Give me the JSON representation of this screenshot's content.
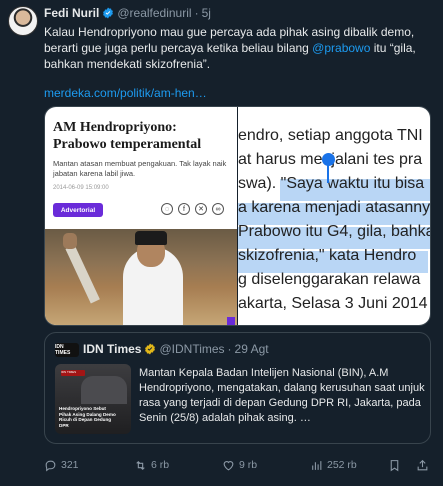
{
  "tweet": {
    "author_name": "Fedi Nuril",
    "handle": "@realfedinuril",
    "separator": "·",
    "time": "5j",
    "text_part1": "Kalau Hendropriyono mau gue percaya ada pihak asing dibalik demo, berarti gue juga perlu percaya ketika beliau bilang ",
    "mention": "@prabowo",
    "text_part2": " itu “gila, bahkan mendekati skizofrenia”.",
    "link": "merdeka.com/politik/am-hen…"
  },
  "card": {
    "title": "AM Hendropriyono: Prabowo temperamental",
    "subtitle": "Mantan atasan membuat pengakuan. Tak layak naik jabatan karena labil jiwa.",
    "date": "2014-06-09 15:09:00",
    "badge": "Advertorial",
    "share_icons": [
      "whatsapp-icon",
      "facebook-icon",
      "x-icon",
      "link-icon"
    ]
  },
  "article_zoom": {
    "lines": [
      "endro, setiap anggota TNI",
      "at harus menjalani tes pra",
      "swa). \"Saya waktu itu bisa",
      "a karena menjadi atasanny",
      "Prabowo itu G4, gila, bahka",
      "skizofrenia,\" kata Hendro",
      "g diselenggarakan relawa",
      "akarta, Selasa 3 Juni 2014"
    ]
  },
  "quote": {
    "logo_text": "IDN TIMES",
    "author_name": "IDN Times",
    "handle": "@IDNTimes",
    "separator": "·",
    "time": "29 Agt",
    "thumb_tag": "IDN TIMES",
    "thumb_caption": "Hendropriyono Sebut Pihak Asing Dalang Demo Ricuh di Depan Gedung DPR",
    "text": "Mantan Kepala Badan Intelijen Nasional (BIN), A.M Hendropriyono, mengatakan, dalang kerusuhan saat unjuk rasa yang terjadi di depan Gedung DPR RI, Jakarta, pada Senin (25/8) adalah pihak asing."
  },
  "actions": {
    "replies": "321",
    "retweets": "6 rb",
    "likes": "9 rb",
    "views": "252 rb"
  },
  "colors": {
    "background": "#15202b",
    "accent": "#1d9bf0",
    "muted": "#8b98a5",
    "badge": "#6a2bd9"
  }
}
